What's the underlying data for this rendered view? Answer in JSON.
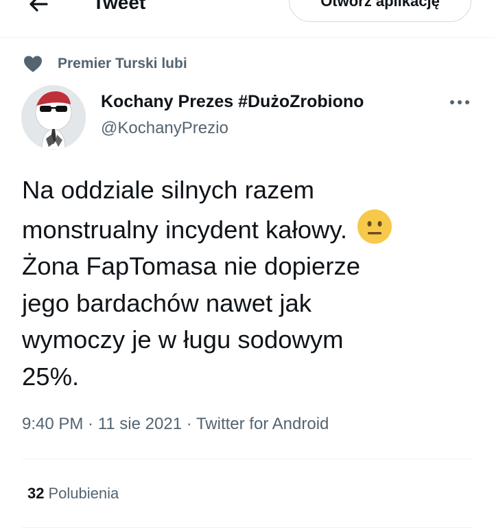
{
  "header": {
    "title": "Tweet",
    "open_app_label": "Otwórz aplikację",
    "back_icon": "arrow-left-icon"
  },
  "social_context": {
    "icon": "heart-icon",
    "text": "Premier Turski lubi"
  },
  "author": {
    "name": "Kochany Prezes #DużoZrobiono",
    "handle": "@KochanyPrezio",
    "avatar": "avatar-image",
    "more_icon": "more-horizontal-icon"
  },
  "tweet": {
    "lines": [
      "Na oddziale silnych razem",
      "monstrualny incydent kałowy.",
      "Żona FapTomasa nie dopierze",
      "jego bardachów nawet jak",
      "wymoczy je w ługu sodowym",
      "25%."
    ],
    "emoji": "neutral-face-emoji"
  },
  "meta": {
    "time": "9:40 PM",
    "separator1": " · ",
    "date": "11 sie 2021",
    "separator2": " · ",
    "source": "Twitter for Android"
  },
  "stats": {
    "likes_count": "32",
    "likes_label": "Polubienia"
  },
  "colors": {
    "text_primary": "#0f1419",
    "text_secondary": "#536471",
    "divider": "#eff3f4",
    "emoji_yellow": "#f7c94a"
  }
}
